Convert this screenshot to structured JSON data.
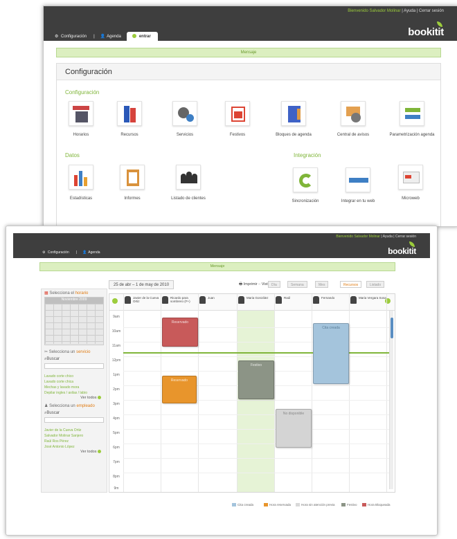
{
  "window1": {
    "header": {
      "user": "Bienvenido Salvador Molinar",
      "links_sep": "|",
      "help": "Ayuda",
      "logout": "Cerrar sesión",
      "logo": "bookitit"
    },
    "nav": {
      "config": "Configuración",
      "sep": "|",
      "agenda": "Agenda",
      "active_tab": "entrar"
    },
    "message": "Mensaje",
    "panel_title": "Configuración",
    "sections": {
      "config": "Configuración",
      "data": "Datos",
      "integration": "Integración"
    },
    "config_items": [
      "Horarios",
      "Recursos",
      "Servicios",
      "Festivos",
      "Bloques de agenda",
      "Central de avisos",
      "Parametrización agenda"
    ],
    "data_items": [
      "Estadísticas",
      "Informes",
      "Listado de clientes"
    ],
    "integration_items": [
      "Sincronización",
      "Integrar en tu web",
      "Microweb"
    ]
  },
  "window2": {
    "header": {
      "user": "Bienvenido Salvador Molinar",
      "help": "Ayuda",
      "logout": "Cerrar sesión",
      "logo": "bookitit"
    },
    "nav": {
      "config": "Configuración",
      "sep": "|",
      "agenda": "Agenda"
    },
    "message": "Mensaje",
    "date_range": "25 de abr – 1 de may de 2010",
    "print": "Imprimir",
    "view_label": "Vista",
    "views": [
      "Día",
      "Semana",
      "Mes",
      "Recursos",
      "Listado"
    ],
    "sidebar": {
      "schedule_prefix": "Selecciona el",
      "schedule_word": "horario",
      "month": "Noviembre 2009",
      "service_prefix": "Selecciona un",
      "service_word": "servicio",
      "search": "Buscar",
      "services": [
        "Lavado corte chico",
        "Lavado corte chica",
        "Mechas y lavado mora",
        "Depilar ingles / axilas / labio"
      ],
      "see_all": "Ver todos",
      "employee_prefix": "Selecciona un",
      "employee_word": "empleado",
      "employees": [
        "Javier de la Cueva Ortiz",
        "Salvador Molinar Sanjero",
        "Raúl Ros Pérez",
        "José Antonio López"
      ]
    },
    "columns": [
      "Javier de la Cueva Ortiz",
      "Ricardo para sombrero (F+)",
      "Juan",
      "Maria González",
      "Raúl",
      "Fernando",
      "Maria Vergara Sosa"
    ],
    "times": [
      "9am",
      "10am",
      "11am",
      "12pm",
      "1pm",
      "2pm",
      "3pm",
      "4pm",
      "5pm",
      "6pm",
      "7pm",
      "8pm",
      "9m"
    ],
    "events": [
      {
        "label": "Reservado",
        "color": "#c85a5a"
      },
      {
        "label": "Reservado",
        "color": "#e8952c"
      },
      {
        "label": "Festivo",
        "color": "#8c9486"
      },
      {
        "label": "No disponible",
        "color": "#d4d4d4"
      },
      {
        "label": "Cita creada",
        "color": "#a4c4dc"
      }
    ],
    "legend": [
      {
        "label": "Cita creada",
        "color": "#a4c4dc"
      },
      {
        "label": "Hora reservada",
        "color": "#e8952c"
      },
      {
        "label": "Hora sin atención previa",
        "color": "#d9d9d9"
      },
      {
        "label": "Festivo",
        "color": "#8c9486"
      },
      {
        "label": "Hora Bloqueada",
        "color": "#c85a5a"
      }
    ]
  }
}
